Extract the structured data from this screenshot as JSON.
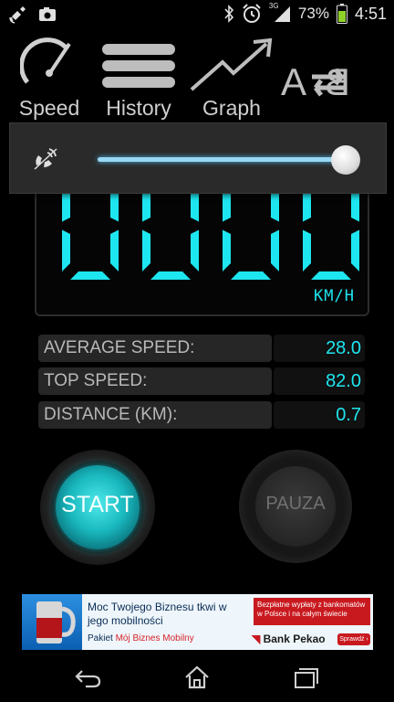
{
  "status_bar": {
    "network_type": "3G",
    "battery_percent": "73%",
    "time": "4:51",
    "icons": [
      "satellite-icon",
      "photo-icon",
      "bluetooth-icon",
      "alarm-icon",
      "signal-icon",
      "battery-icon"
    ]
  },
  "tabs": [
    {
      "label": "Speed",
      "icon": "speedometer-icon"
    },
    {
      "label": "History",
      "icon": "history-lines-icon"
    },
    {
      "label": "Graph",
      "icon": "graph-line-icon"
    },
    {
      "label": "",
      "icon": "a-b-swap-icon"
    }
  ],
  "volume": {
    "icon": "ringer-volume-icon",
    "level": 1.0
  },
  "speed_display": {
    "value": "0000",
    "unit": "KM/H",
    "color": "#1ee6f0"
  },
  "stats": [
    {
      "label": "AVERAGE SPEED:",
      "value": "28.0"
    },
    {
      "label": "TOP SPEED:",
      "value": "82.0"
    },
    {
      "label": "DISTANCE (KM):",
      "value": "0.7"
    }
  ],
  "buttons": {
    "start": "START",
    "pause": "PAUZA"
  },
  "ad": {
    "headline": "Moc Twojego Biznesu tkwi w jego mobilności",
    "package_prefix": "Pakiet",
    "package_name": "Mój Biznes Mobilny",
    "promo": "Bezpłatne wypłaty z bankomatów w Polsce i na całym świecie",
    "brand": "Bank Pekao",
    "cta": "Sprawdź ›"
  },
  "navbar": {
    "icons": [
      "back-icon",
      "home-icon",
      "recent-apps-icon"
    ]
  }
}
